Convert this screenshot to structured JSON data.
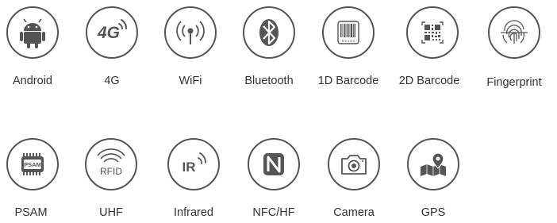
{
  "features": [
    {
      "label": "Android",
      "icon": "android-icon"
    },
    {
      "label": "4G",
      "icon": "4g-icon",
      "icon_text": "4G"
    },
    {
      "label": "WiFi",
      "icon": "wifi-icon"
    },
    {
      "label": "Bluetooth",
      "icon": "bluetooth-icon"
    },
    {
      "label": "1D Barcode",
      "icon": "barcode-1d-icon",
      "icon_text": "6 5 1 8 2"
    },
    {
      "label": "2D Barcode",
      "icon": "qr-code-icon"
    },
    {
      "label": "Fingerprint",
      "icon": "fingerprint-icon"
    },
    {
      "label": "PSAM",
      "icon": "psam-chip-icon",
      "icon_text": "PSAM"
    },
    {
      "label": "UHF",
      "icon": "rfid-icon",
      "icon_text": "RFID"
    },
    {
      "label": "Infrared",
      "icon": "infrared-icon",
      "icon_text": "IR"
    },
    {
      "label": "NFC/HF",
      "icon": "nfc-icon"
    },
    {
      "label": "Camera",
      "icon": "camera-icon"
    },
    {
      "label": "GPS",
      "icon": "gps-map-icon"
    }
  ],
  "colors": {
    "icon_fill": "#555555",
    "label_text": "#333333",
    "background": "#ffffff"
  }
}
